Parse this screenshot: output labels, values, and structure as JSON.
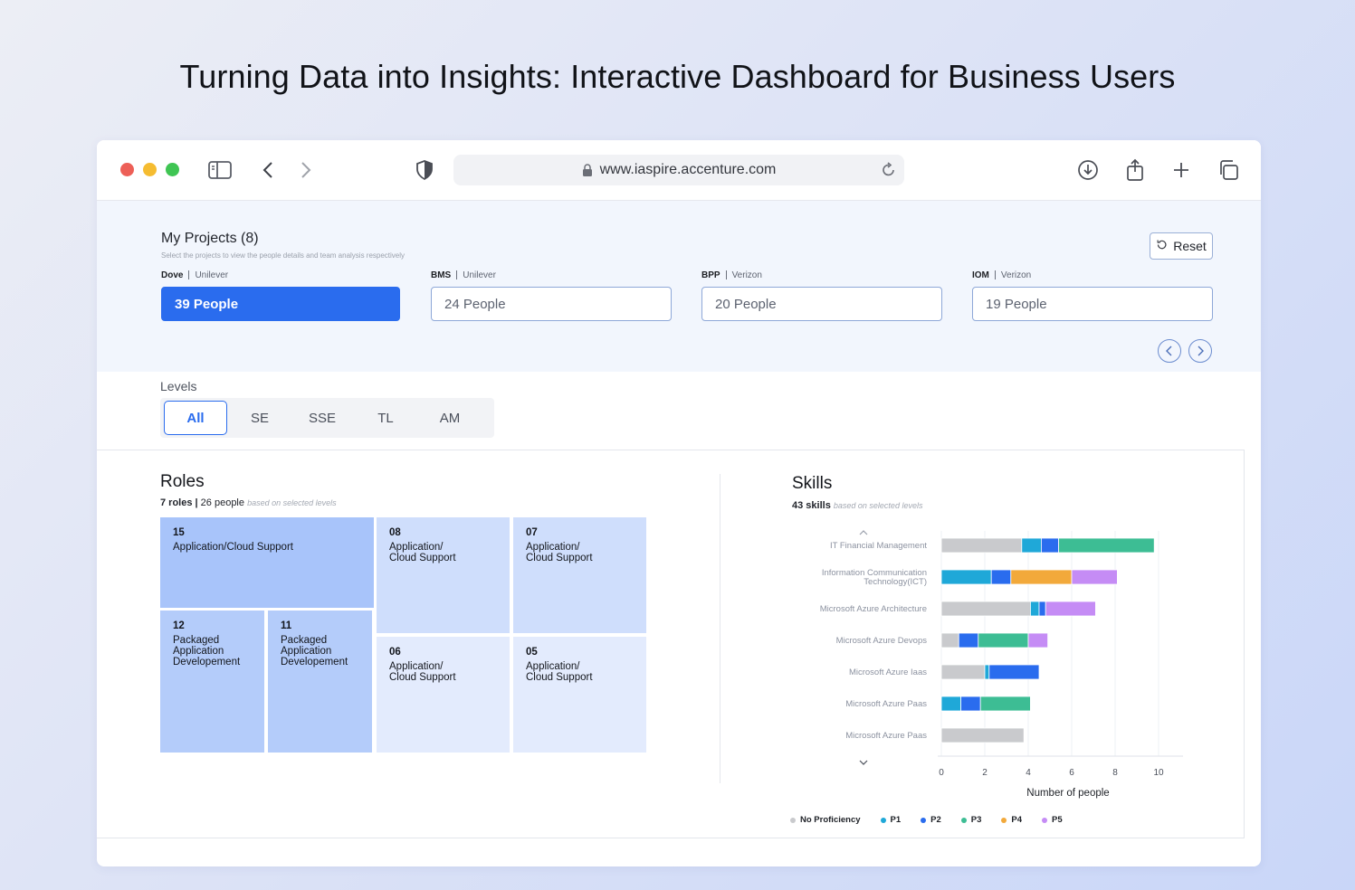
{
  "page_title": "Turning Data into Insights: Interactive Dashboard for Business Users",
  "browser": {
    "url": "www.iaspire.accenture.com"
  },
  "projects": {
    "title": "My Projects (8)",
    "subtitle": "Select the projects to view the people details and team analysis respectively",
    "reset_label": "Reset",
    "cards": [
      {
        "code": "Dove",
        "client": "Unilever",
        "people": "39 People",
        "active": true
      },
      {
        "code": "BMS",
        "client": "Unilever",
        "people": "24 People",
        "active": false
      },
      {
        "code": "BPP",
        "client": "Verizon",
        "people": "20 People",
        "active": false
      },
      {
        "code": "IOM",
        "client": "Verizon",
        "people": "19 People",
        "active": false
      }
    ]
  },
  "levels": {
    "label": "Levels",
    "tabs": [
      "All",
      "SE",
      "SSE",
      "TL",
      "AM"
    ],
    "selected": "All"
  },
  "roles": {
    "title": "Roles",
    "count": "7 roles",
    "people": "26 people",
    "note": "based on selected levels",
    "tiles": [
      {
        "num": "15",
        "label": "Application/Cloud Support"
      },
      {
        "num": "12",
        "label": "Packaged Application Developement"
      },
      {
        "num": "11",
        "label": "Packaged Application Developement"
      },
      {
        "num": "08",
        "label": "Application/ Cloud Support"
      },
      {
        "num": "07",
        "label": "Application/ Cloud Support"
      },
      {
        "num": "06",
        "label": "Application/ Cloud Support"
      },
      {
        "num": "05",
        "label": "Application/ Cloud Support"
      }
    ]
  },
  "skills": {
    "title": "Skills",
    "count": "43 skills",
    "note": "based on selected levels"
  },
  "colors": {
    "accent": "#2a6cee",
    "No Proficiency": "#c9cacd",
    "P1": "#1fa8d8",
    "P2": "#2a6cee",
    "P3": "#3dbd94",
    "P4": "#f2a93b",
    "P5": "#c58cf5"
  },
  "chart_data": {
    "type": "bar",
    "orientation": "horizontal",
    "stacked": true,
    "categories": [
      "IT Financial Management",
      "Information Communication Technology(ICT)",
      "Microsoft Azure Architecture",
      "Microsoft Azure Devops",
      "Microsoft Azure Iaas",
      "Microsoft Azure Paas",
      "Microsoft Azure Paas"
    ],
    "series": [
      {
        "name": "No Proficiency",
        "values": [
          3.7,
          0,
          4.1,
          0.8,
          2.0,
          0,
          3.8
        ]
      },
      {
        "name": "P1",
        "values": [
          0.9,
          2.3,
          0.4,
          0,
          0.2,
          0.9,
          0
        ]
      },
      {
        "name": "P2",
        "values": [
          0.8,
          0.9,
          0.3,
          0.9,
          2.3,
          0.9,
          0
        ]
      },
      {
        "name": "P3",
        "values": [
          4.4,
          0,
          0,
          2.3,
          0,
          2.3,
          0
        ]
      },
      {
        "name": "P4",
        "values": [
          0,
          2.8,
          0,
          0,
          0,
          0,
          0
        ]
      },
      {
        "name": "P5",
        "values": [
          0,
          2.1,
          2.3,
          0.9,
          0,
          0,
          0
        ]
      }
    ],
    "xlabel": "Number of people",
    "xlim": [
      0,
      10
    ],
    "xticks": [
      0,
      2,
      4,
      6,
      8,
      10
    ],
    "legend": [
      "No Proficiency",
      "P1",
      "P2",
      "P3",
      "P4",
      "P5"
    ],
    "legend_position": "bottom",
    "grid": true
  }
}
